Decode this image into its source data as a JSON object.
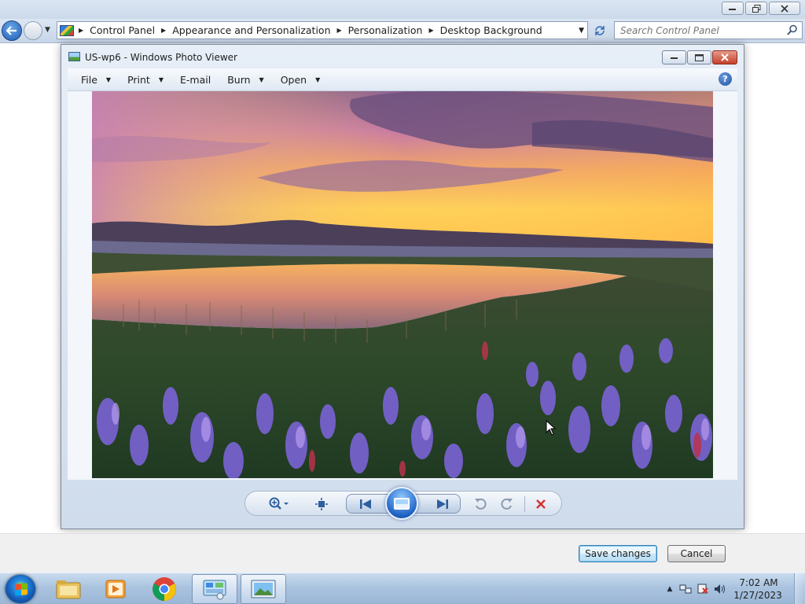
{
  "explorer": {
    "breadcrumbs": [
      "Control Panel",
      "Appearance and Personalization",
      "Personalization",
      "Desktop Background"
    ],
    "search_placeholder": "Search Control Panel"
  },
  "photo_viewer": {
    "title": "US-wp6 - Windows Photo Viewer",
    "menu": [
      "File",
      "Print",
      "E-mail",
      "Burn",
      "Open"
    ],
    "menu_has_dropdown": [
      true,
      true,
      false,
      true,
      true
    ],
    "photo_subject": "sunset over lake with purple wildflowers and mountains"
  },
  "actions": {
    "save_label": "Save changes",
    "cancel_label": "Cancel"
  },
  "taskbar": {
    "pinned": [
      "file-explorer-icon",
      "media-player-icon",
      "chrome-icon",
      "control-panel-icon",
      "photo-viewer-icon"
    ],
    "active": [
      "control-panel-icon",
      "photo-viewer-icon"
    ],
    "clock_time": "7:02 AM",
    "clock_date": "1/27/2023"
  },
  "colors": {
    "accent": "#3c7fb1",
    "close_red": "#c4402a",
    "delete_red": "#d6312b"
  }
}
